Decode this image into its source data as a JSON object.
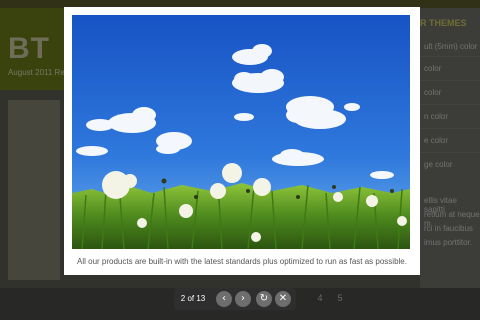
{
  "background_page": {
    "logo_text": "BT",
    "header_subtitle": "August 2011 Re",
    "sidebar_title": "R THEMES",
    "sidebar_items": [
      "ult (5mm) color",
      "color",
      "color",
      "n color",
      "e color",
      "ge color"
    ],
    "sidebar_text_lines": [
      "ellis vitae sagitti",
      "retium at neque m",
      "rci in faucibus",
      "imus porttitor."
    ],
    "pagination": [
      "4",
      "5"
    ]
  },
  "lightbox": {
    "caption": "All our products are built-in with the latest standards plus optimized to run as fast as possible.",
    "counter": "2 of 13",
    "controls": {
      "prev_icon": "chevron-left-icon",
      "next_icon": "chevron-right-icon",
      "slideshow_icon": "refresh-icon",
      "close_icon": "close-icon"
    }
  },
  "colors": {
    "sky_top": "#1a5ec9",
    "sky_bottom": "#4a93e6",
    "grass": "#6aa02a",
    "control_bar": "#2e2e2e",
    "header_bg": "#6b7a1a"
  }
}
